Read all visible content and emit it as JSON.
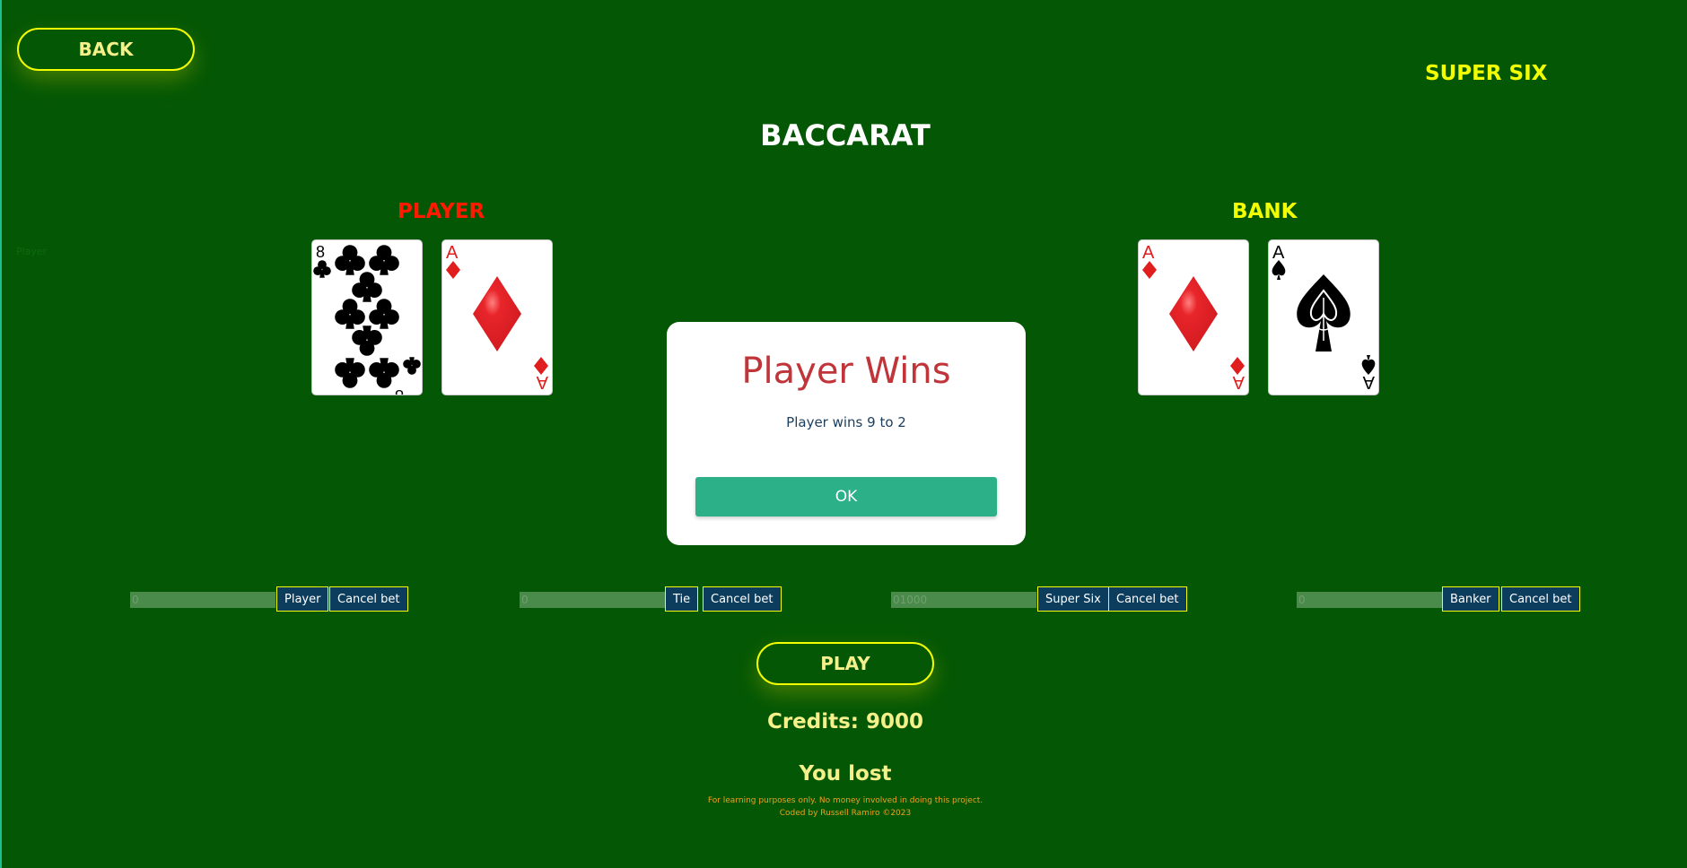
{
  "header": {
    "back_label": "BACK",
    "mode_label": "SUPER SIX",
    "title": "BACCARAT"
  },
  "table": {
    "player_label": "PLAYER",
    "bank_label": "BANK",
    "faint_text": "Player",
    "player_cards": [
      {
        "rank": "8",
        "suit": "clubs",
        "color": "#000000"
      },
      {
        "rank": "A",
        "suit": "diamonds",
        "color": "#e01e1e"
      }
    ],
    "bank_cards": [
      {
        "rank": "A",
        "suit": "diamonds",
        "color": "#e01e1e"
      },
      {
        "rank": "A",
        "suit": "spades",
        "color": "#000000"
      }
    ]
  },
  "modal": {
    "title": "Player Wins",
    "text": "Player wins 9 to 2",
    "ok_label": "OK"
  },
  "bets": [
    {
      "value": "0",
      "button": "Player",
      "cancel": "Cancel bet"
    },
    {
      "value": "0",
      "button": "Tie",
      "cancel": "Cancel bet"
    },
    {
      "value": "01000",
      "button": "Super Six",
      "cancel": "Cancel bet"
    },
    {
      "value": "0",
      "button": "Banker",
      "cancel": "Cancel bet"
    }
  ],
  "play_label": "PLAY",
  "credits": "Credits: 9000",
  "result": "You lost",
  "footer": {
    "line1": "For learning purposes only. No money involved in doing this project.",
    "line2": "Coded by Russell Ramiro ©2023"
  },
  "colors": {
    "felt": "#045704",
    "accent": "#f2ff00",
    "player": "#ff1a00",
    "ok": "#2cb087"
  }
}
